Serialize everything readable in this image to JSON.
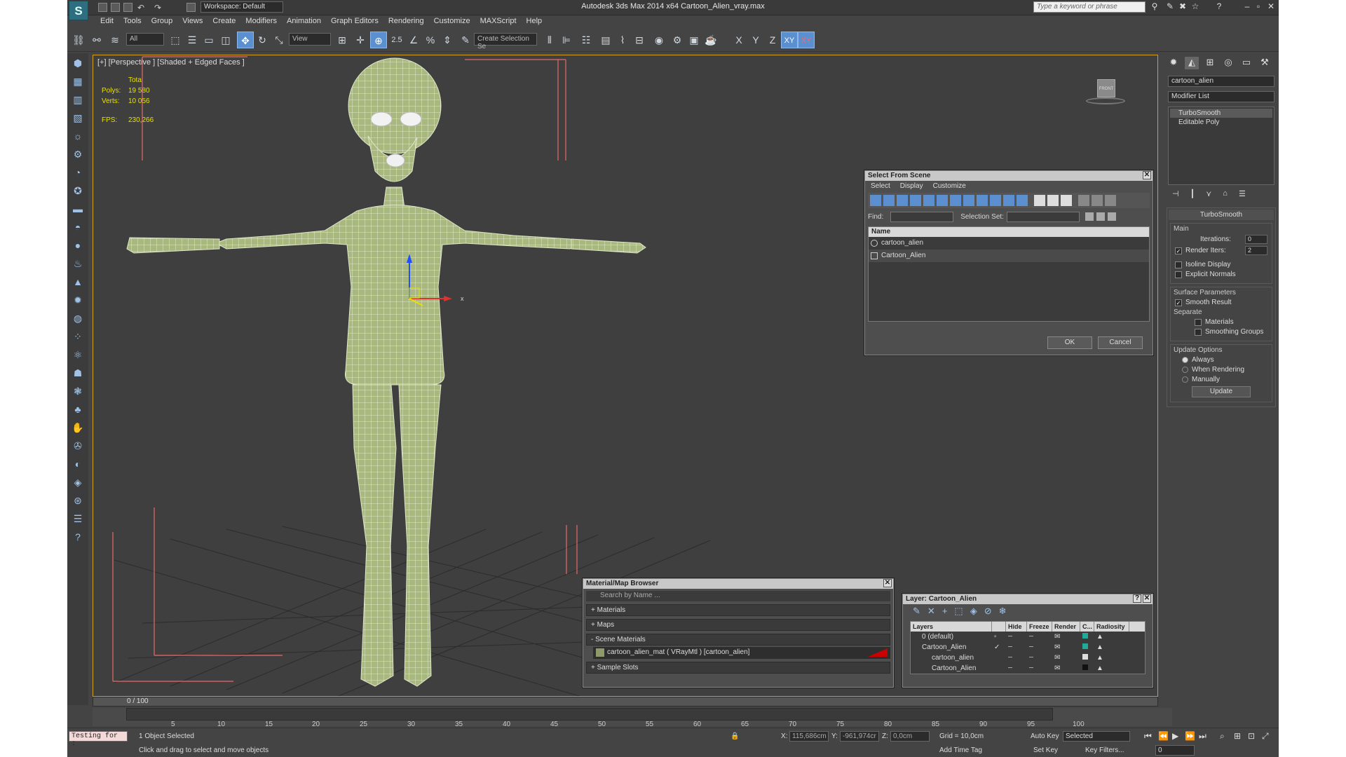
{
  "titlebar": {
    "workspace": "Workspace: Default",
    "title": "Autodesk 3ds Max  2014 x64     Cartoon_Alien_vray.max",
    "search_placeholder": "Type a keyword or phrase"
  },
  "menu": [
    "Edit",
    "Tools",
    "Group",
    "Views",
    "Create",
    "Modifiers",
    "Animation",
    "Graph Editors",
    "Rendering",
    "Customize",
    "MAXScript",
    "Help"
  ],
  "toolbar": {
    "filter_value": "All",
    "ref_coord_value": "View",
    "selection_set_placeholder": "Create Selection Se",
    "snap_label": "2.5",
    "axes": [
      "X",
      "Y",
      "Z",
      "XY",
      "XY"
    ]
  },
  "viewport": {
    "label": "[+] [Perspective ] [Shaded + Edged Faces ]",
    "stats": {
      "header": "Total",
      "polys_label": "Polys:",
      "polys_value": "19 580",
      "verts_label": "Verts:",
      "verts_value": "10 056",
      "fps_label": "FPS:",
      "fps_value": "230,266"
    },
    "viewcube_label": "FRONT",
    "gizmo_x_label": "x"
  },
  "timeline": {
    "slider": "0 / 100",
    "ticks": [
      "5",
      "10",
      "15",
      "20",
      "25",
      "30",
      "35",
      "40",
      "45",
      "50",
      "55",
      "60",
      "65",
      "70",
      "75",
      "80",
      "85",
      "90",
      "95",
      "100"
    ]
  },
  "status": {
    "left_input": "Testing for :",
    "selection_info": "1 Object Selected",
    "prompt": "Click and drag to select and move objects",
    "x_label": "X:",
    "x_value": "115,686cm",
    "y_label": "Y:",
    "y_value": "-961,974cr",
    "z_label": "Z:",
    "z_value": "0,0cm",
    "grid": "Grid = 10,0cm",
    "add_time_tag": "Add Time Tag",
    "auto_key": "Auto Key",
    "auto_key_mode": "Selected",
    "set_key": "Set Key",
    "key_filters": "Key Filters...",
    "frame_value": "0"
  },
  "command_panel": {
    "object_name": "cartoon_alien",
    "modifier_list": "Modifier List",
    "stack": [
      "TurboSmooth",
      "Editable Poly"
    ],
    "turbosmooth": {
      "title": "TurboSmooth",
      "main_group": "Main",
      "iterations_label": "Iterations:",
      "iterations_value": "0",
      "render_iters_label": "Render Iters:",
      "render_iters_value": "2",
      "isoline": "Isoline Display",
      "explicit_normals": "Explicit Normals",
      "surface_group": "Surface Parameters",
      "smooth_result": "Smooth Result",
      "separate": "Separate",
      "materials": "Materials",
      "smoothing_groups": "Smoothing Groups",
      "update_group": "Update Options",
      "always": "Always",
      "when_rendering": "When Rendering",
      "manually": "Manually",
      "update_btn": "Update"
    }
  },
  "select_dialog": {
    "title": "Select From Scene",
    "menu": [
      "Select",
      "Display",
      "Customize"
    ],
    "find_label": "Find:",
    "selection_set_label": "Selection Set:",
    "column": "Name",
    "rows": [
      "cartoon_alien",
      "Cartoon_Alien"
    ],
    "ok": "OK",
    "cancel": "Cancel"
  },
  "material_browser": {
    "title": "Material/Map Browser",
    "search": "Search by Name ...",
    "cats": [
      "+ Materials",
      "+ Maps",
      "- Scene Materials"
    ],
    "item": "cartoon_alien_mat  ( VRayMtl )  [cartoon_alien]",
    "sample_slots": "+ Sample Slots"
  },
  "layer_dialog": {
    "title": "Layer: Cartoon_Alien",
    "headers": [
      "Layers",
      "",
      "Hide",
      "Freeze",
      "Render",
      "C...",
      "Radiosity"
    ],
    "rows": [
      "0 (default)",
      "Cartoon_Alien",
      "cartoon_alien",
      "Cartoon_Alien"
    ]
  },
  "colors": {
    "viewport_bg": "#3f3f3f",
    "mesh_fill": "#a9b87f",
    "active_border": "#d4a017",
    "stats_yellow": "#e8e000"
  }
}
